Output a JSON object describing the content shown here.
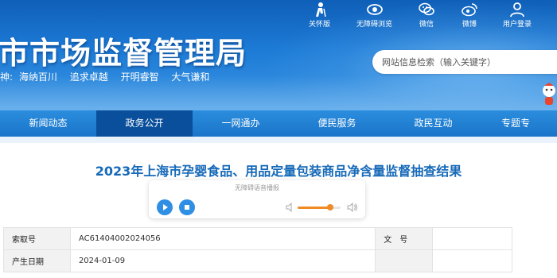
{
  "header": {
    "site_title": "市市场监督管理局",
    "motto_prefix": "神:",
    "motto": [
      "海纳百川",
      "追求卓越",
      "开明睿智",
      "大气谦和"
    ]
  },
  "tools": [
    {
      "label": "关怀版",
      "icon": "elder-care-icon"
    },
    {
      "label": "无障碍浏览",
      "icon": "accessibility-eye-icon"
    },
    {
      "label": "微信",
      "icon": "wechat-icon"
    },
    {
      "label": "微博",
      "icon": "weibo-icon"
    },
    {
      "label": "用户登录",
      "icon": "user-login-icon"
    }
  ],
  "search": {
    "placeholder": "网站信息检索（输入关键字）"
  },
  "nav": {
    "items": [
      {
        "label": "新闻动态"
      },
      {
        "label": "政务公开",
        "active": true
      },
      {
        "label": "一网通办"
      },
      {
        "label": "便民服务"
      },
      {
        "label": "政民互动"
      },
      {
        "label": "专题专"
      }
    ]
  },
  "article": {
    "title": "2023年上海市孕婴食品、用品定量包装商品净含量监督抽查结果"
  },
  "player": {
    "title": "无障碍语音播报",
    "volume_level": 0.75
  },
  "meta": {
    "index_label": "索取号",
    "index_value": "AC61404002024056",
    "doc_no_label": "文　号",
    "doc_no_value": "",
    "date_label": "产生日期",
    "date_value": "2024-01-09"
  },
  "colors": {
    "header_blue": "#1d7bd6",
    "nav_active": "#0a4f9b",
    "title_blue": "#1669b8",
    "accent_orange": "#f08a24",
    "player_blue": "#2f8fe4"
  }
}
